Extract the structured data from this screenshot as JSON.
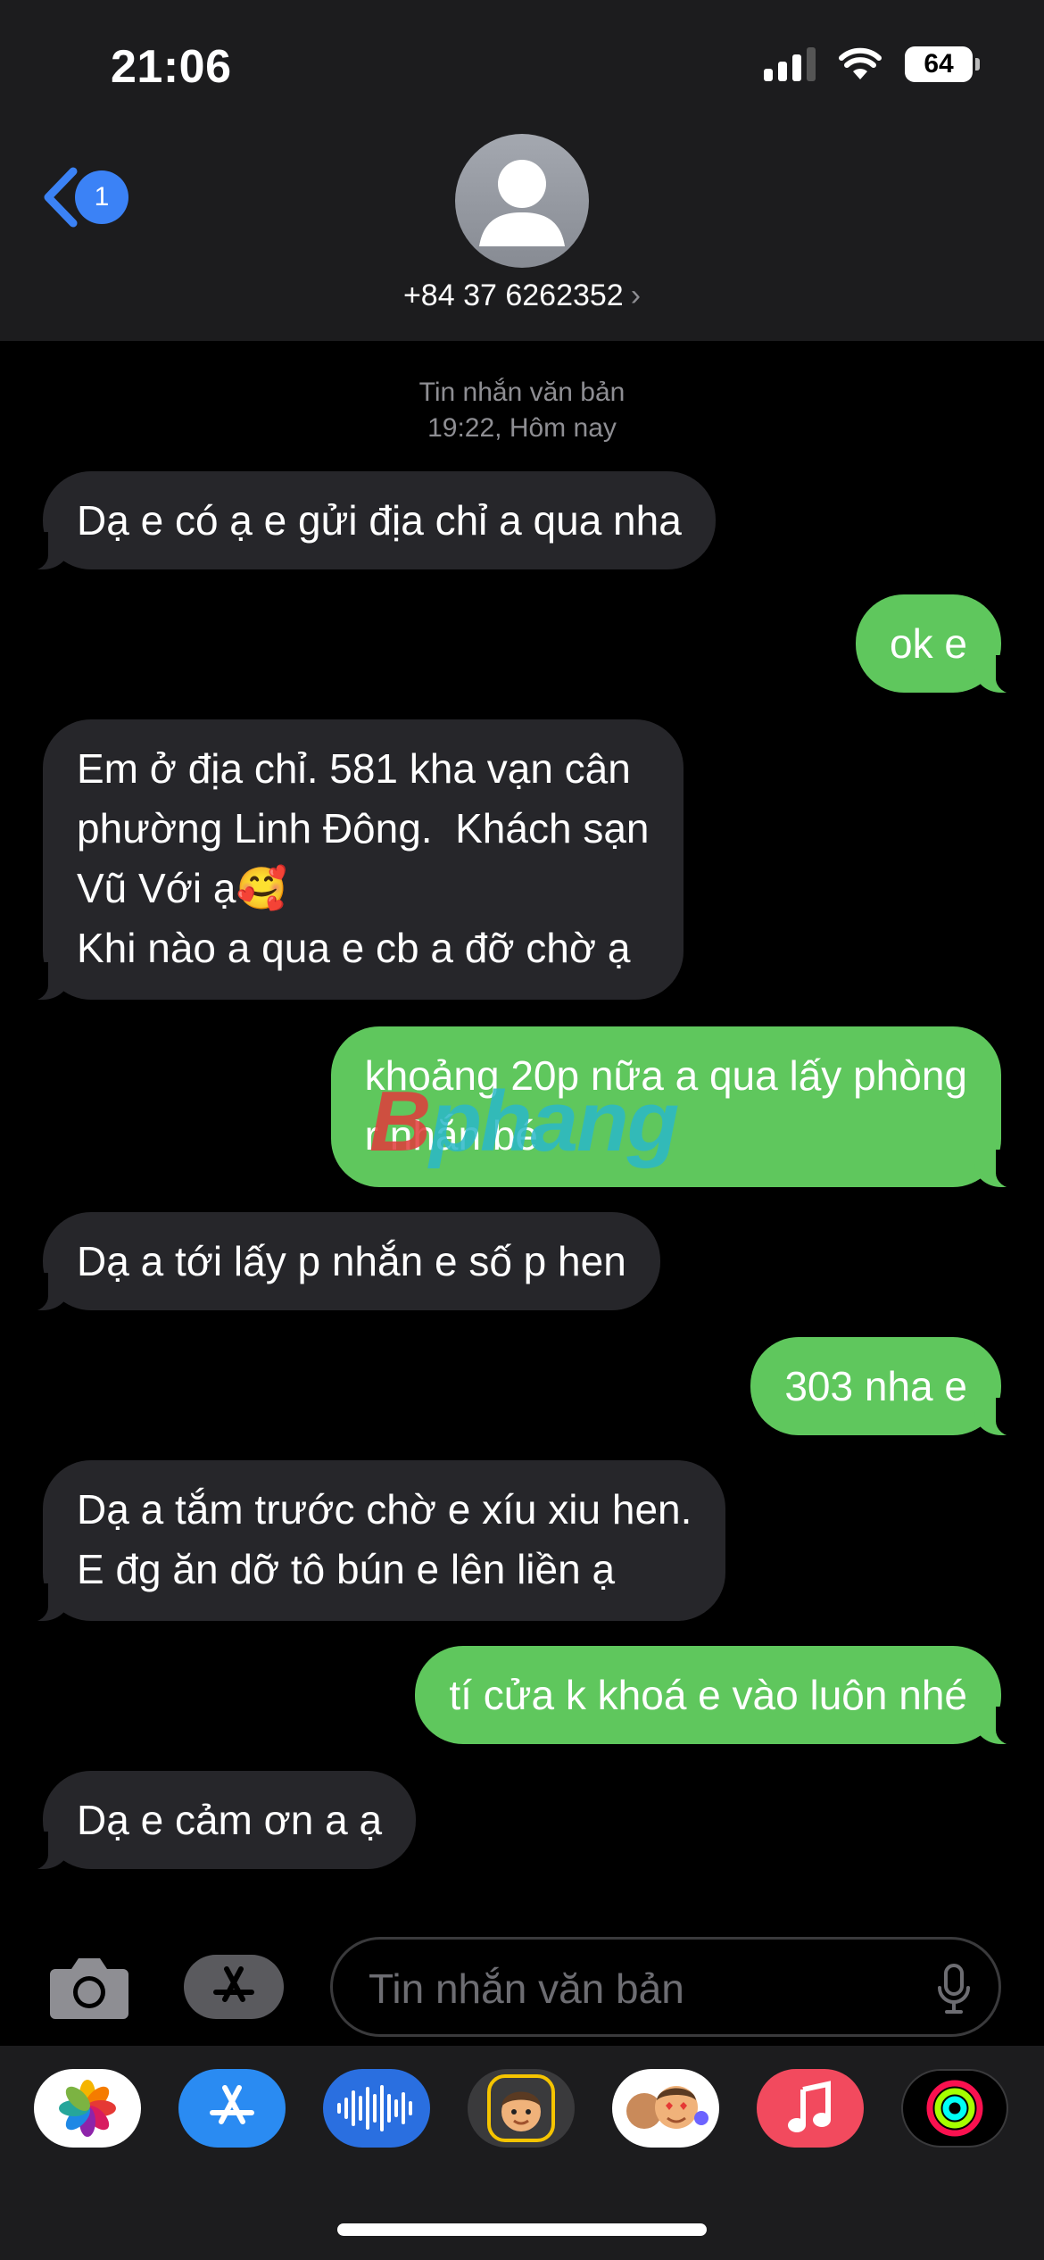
{
  "status_bar": {
    "time": "21:06",
    "battery": "64"
  },
  "header": {
    "back_count": "1",
    "contact": "+84 37 6262352",
    "chevron": "›"
  },
  "thread": {
    "meta_type": "Tin nhắn văn bản",
    "meta_time": "19:22, Hôm nay",
    "messages": [
      {
        "dir": "in",
        "text": "Dạ e có ạ e gửi địa chỉ a qua nha"
      },
      {
        "dir": "out",
        "text": "ok e"
      },
      {
        "dir": "in",
        "text": "Em ở địa chỉ. 581 kha vạn cân\nphường Linh Đông.  Khách sạn\nVũ Với ạ🥰\nKhi nào a qua e cb a đỡ chờ ạ"
      },
      {
        "dir": "out",
        "text": "khoảng 20p nữa a qua lấy phòng\nr nhắn bé"
      },
      {
        "dir": "in",
        "text": "Dạ a tới lấy p nhắn e số p hen"
      },
      {
        "dir": "out",
        "text": "303 nha e"
      },
      {
        "dir": "in",
        "text": "Dạ a tắm trước chờ e xíu xiu hen.\nE đg ăn dỡ tô bún e lên liền ạ"
      },
      {
        "dir": "out",
        "text": "tí cửa k khoá e vào luôn nhé"
      },
      {
        "dir": "in",
        "text": "Dạ e cảm ơn a ạ"
      }
    ]
  },
  "watermark": {
    "a": "B",
    "b": "phang"
  },
  "composer": {
    "placeholder": "Tin nhắn văn bản"
  },
  "dock_apps": [
    "photos-icon",
    "app-store-icon",
    "voice-memo-icon",
    "memoji-icon",
    "memoji-stickers-icon",
    "music-icon",
    "activity-icon"
  ],
  "colors": {
    "outgoing": "#5fc75d",
    "incoming": "#26262a",
    "accent": "#3b82f6"
  }
}
